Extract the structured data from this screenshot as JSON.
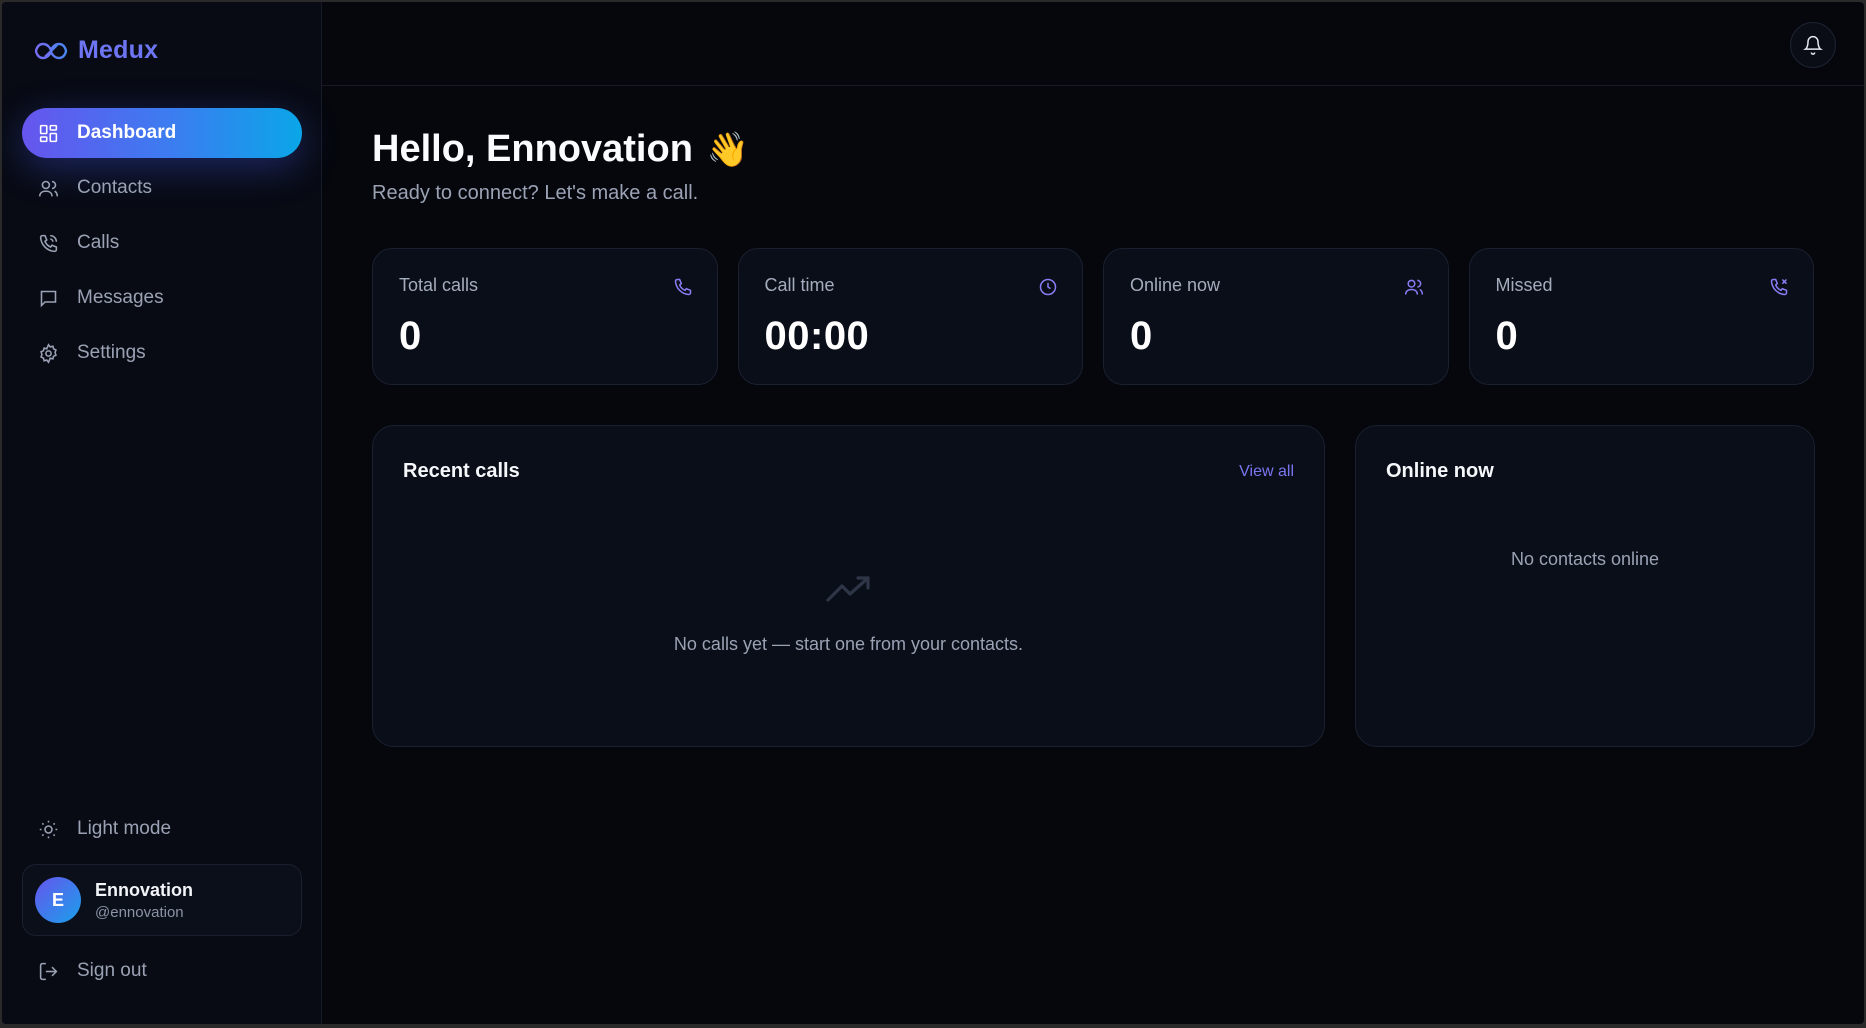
{
  "brand": {
    "name": "Medux"
  },
  "nav": {
    "items": [
      {
        "label": "Dashboard",
        "icon": "dashboard-icon",
        "active": true
      },
      {
        "label": "Contacts",
        "icon": "users-icon",
        "active": false
      },
      {
        "label": "Calls",
        "icon": "phone-call-icon",
        "active": false
      },
      {
        "label": "Messages",
        "icon": "message-square-icon",
        "active": false
      },
      {
        "label": "Settings",
        "icon": "gear-icon",
        "active": false
      }
    ]
  },
  "sidebar": {
    "light_mode_label": "Light mode",
    "sign_out_label": "Sign out"
  },
  "user": {
    "initial": "E",
    "name": "Ennovation",
    "handle": "@ennovation"
  },
  "header": {
    "greeting": "Hello, Ennovation",
    "wave": "👋",
    "subtitle": "Ready to connect? Let's make a call."
  },
  "stats": [
    {
      "label": "Total calls",
      "value": "0",
      "icon": "phone-icon"
    },
    {
      "label": "Call time",
      "value": "00:00",
      "icon": "clock-icon"
    },
    {
      "label": "Online now",
      "value": "0",
      "icon": "users-icon"
    },
    {
      "label": "Missed",
      "value": "0",
      "icon": "phone-missed-icon"
    }
  ],
  "recent_calls": {
    "title": "Recent calls",
    "view_all": "View all",
    "empty_text": "No calls yet — start one from your contacts."
  },
  "online_now": {
    "title": "Online now",
    "empty_text": "No contacts online"
  },
  "colors": {
    "accent": "#6e75f2",
    "accent_gradient_start": "#6655ee",
    "accent_gradient_end": "#0aa6e8",
    "background": "#05070d",
    "card": "#0a0e18",
    "icon_accent": "#8b7cf6"
  }
}
